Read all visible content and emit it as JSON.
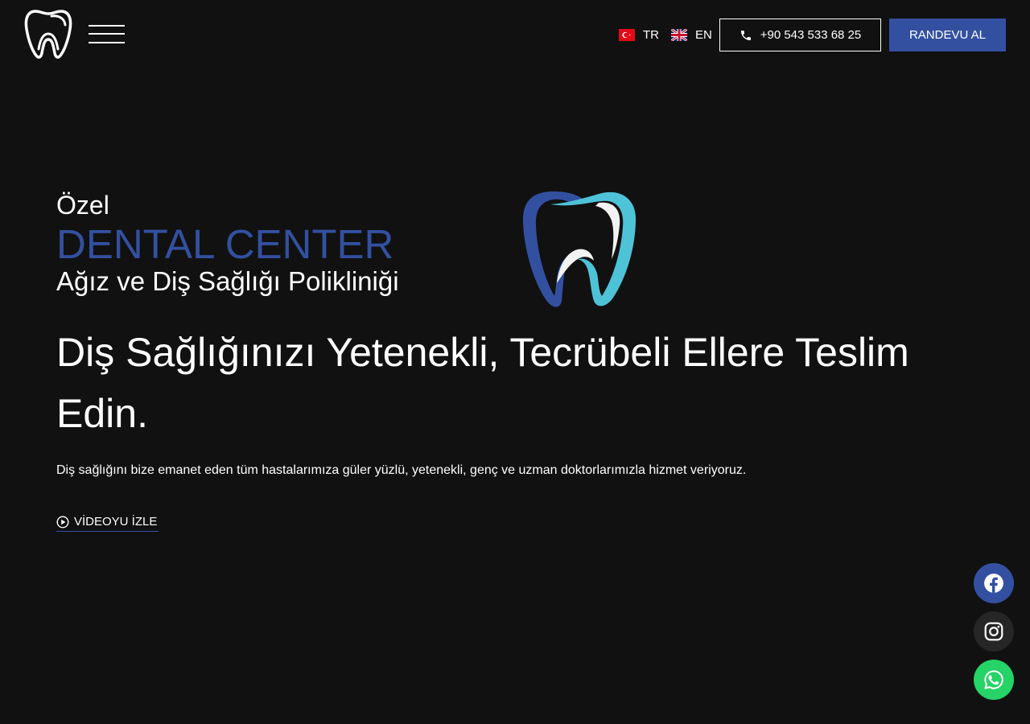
{
  "header": {
    "logo_icon": "tooth-outline-icon",
    "menu_icon": "hamburger-icon",
    "languages": [
      {
        "code": "TR",
        "flag_icon": "turkey-flag-icon"
      },
      {
        "code": "EN",
        "flag_icon": "uk-flag-icon"
      }
    ],
    "phone": {
      "icon": "phone-icon",
      "label": "+90 543 533 68 25"
    },
    "cta_label": "RANDEVU AL"
  },
  "hero": {
    "eyebrow": "Özel",
    "brand": "DENTAL CENTER",
    "subtitle": "Ağız ve Diş Sağlığı Polikliniği",
    "tooth_icon": "tooth-logo-icon",
    "headline": "Diş Sağlığınızı Yetenekli, Tecrübeli Ellere Teslim Edin.",
    "lead": "Diş sağlığını bize emanet eden tüm hastalarımıza güler yüzlü, yetenekli, genç ve uzman doktorlarımızla hizmet veriyoruz.",
    "video_link": {
      "icon": "play-circle-icon",
      "label": "VİDEOYU İZLE"
    }
  },
  "social": [
    {
      "name": "facebook",
      "icon": "facebook-icon"
    },
    {
      "name": "instagram",
      "icon": "instagram-icon"
    },
    {
      "name": "whatsapp",
      "icon": "whatsapp-icon"
    }
  ],
  "colors": {
    "background": "#111111",
    "brand_blue": "#3350a0",
    "tooth_cyan": "#4ec3d8",
    "whatsapp_green": "#25d366",
    "text": "#ffffff"
  }
}
